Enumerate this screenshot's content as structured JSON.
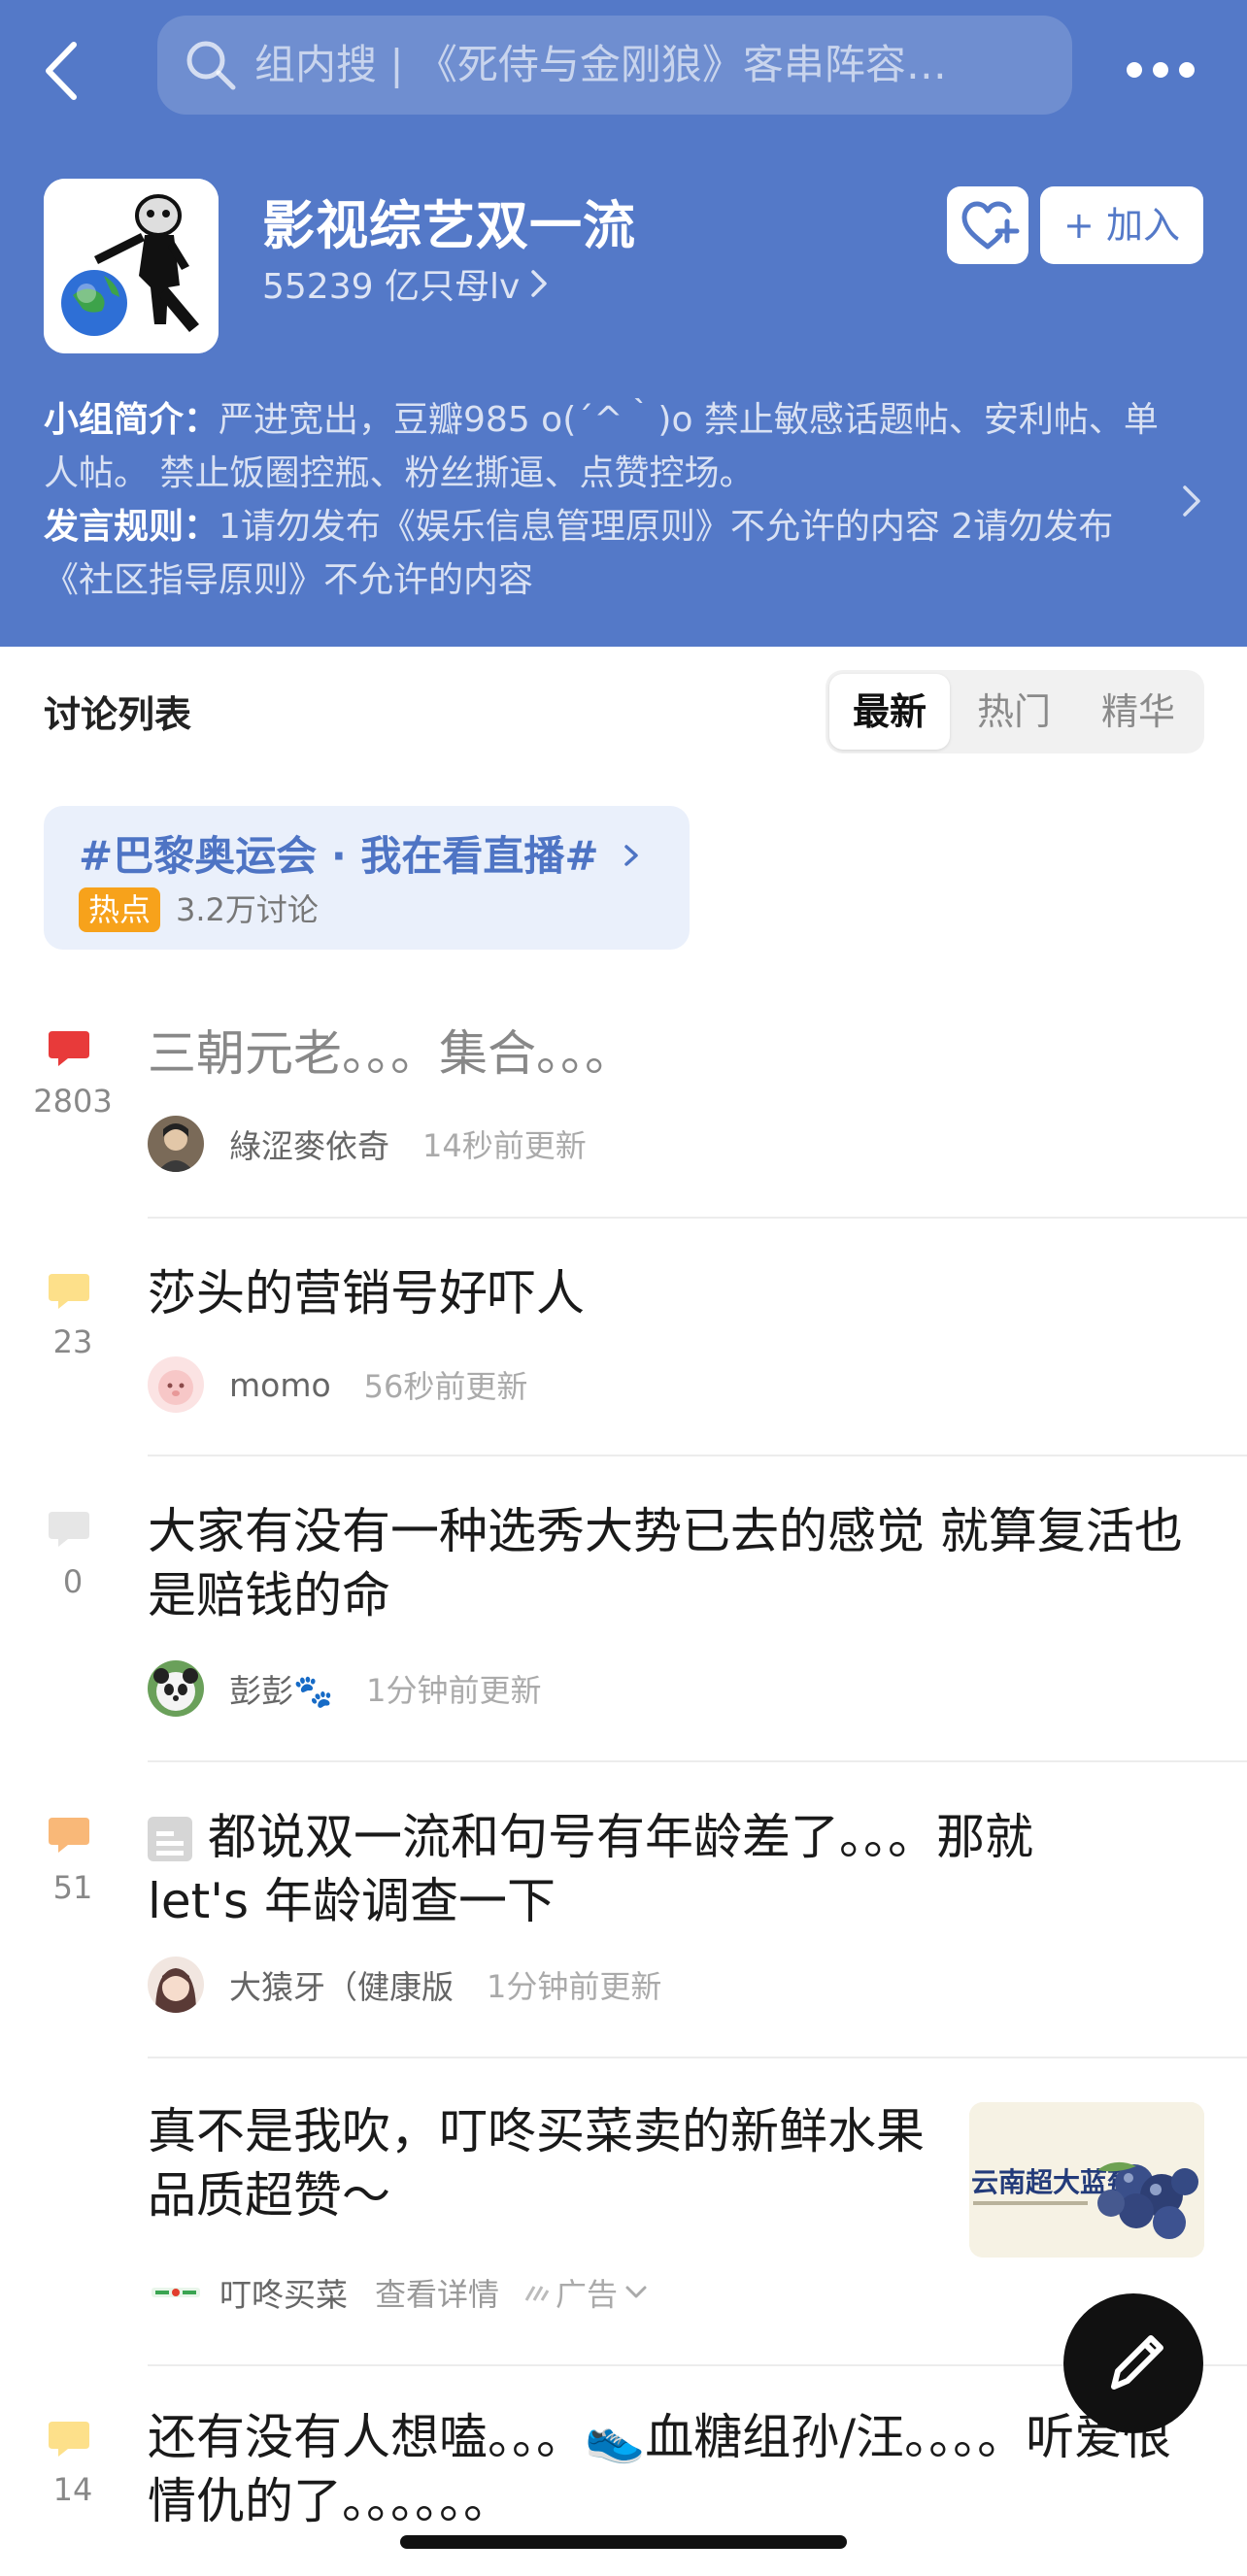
{
  "header": {
    "search_placeholder": "组内搜 | 《死侍与金刚狼》客串阵容…"
  },
  "group": {
    "name": "影视综艺双一流",
    "members": "55239 亿只母lv",
    "join_label": "+ 加入",
    "intro_label": "小组简介：",
    "intro_text": "严进宽出，豆瓣985   o(´^｀)o  禁止敏感话题帖、安利帖、单人帖。 禁止饭圈控瓶、粉丝撕逼、点赞控场。",
    "rules_label": "发言规则：",
    "rules_text": "1请勿发布《娱乐信息管理原则》不允许的内容 2请勿发布《社区指导原则》不允许的内容"
  },
  "discussion": {
    "title": "讨论列表",
    "tabs": [
      "最新",
      "热门",
      "精华"
    ],
    "active_tab": "最新"
  },
  "topic": {
    "title": "#巴黎奥运会 · 我在看直播#",
    "badge": "热点",
    "count": "3.2万讨论"
  },
  "posts": [
    {
      "title": "三朝元老。。。集合。。。",
      "replies": "2803",
      "author": "綠涩麥依奇",
      "time": "14秒前更新",
      "bubble_color": "#e83a3a"
    },
    {
      "title": "莎头的营销号好吓人",
      "replies": "23",
      "author": "momo",
      "time": "56秒前更新",
      "bubble_color": "#fde08a"
    },
    {
      "title": "大家有没有一种选秀大势已去的感觉 就算复活也是赔钱的命",
      "replies": "0",
      "author": "彭彭🐾",
      "time": "1分钟前更新",
      "bubble_color": "#e6e6e6"
    },
    {
      "title": "都说双一流和句号有年龄差了。。。那就let's 年龄调查一下",
      "replies": "51",
      "author": "大猿牙（健康版",
      "time": "1分钟前更新",
      "bubble_color": "#f9b878"
    },
    {
      "title": "还有没有人想嗑。。。👟血糖组孙/汪。。。。听爱恨情仇的了。。。。。。",
      "replies": "14",
      "bubble_color": "#fde08a"
    }
  ],
  "ad": {
    "title": "真不是我吹，叮咚买菜卖的新鲜水果品质超赞～",
    "brand": "叮咚买菜",
    "detail": "查看详情",
    "tag": "广告",
    "thumb_text": "云南超大蓝莓"
  }
}
